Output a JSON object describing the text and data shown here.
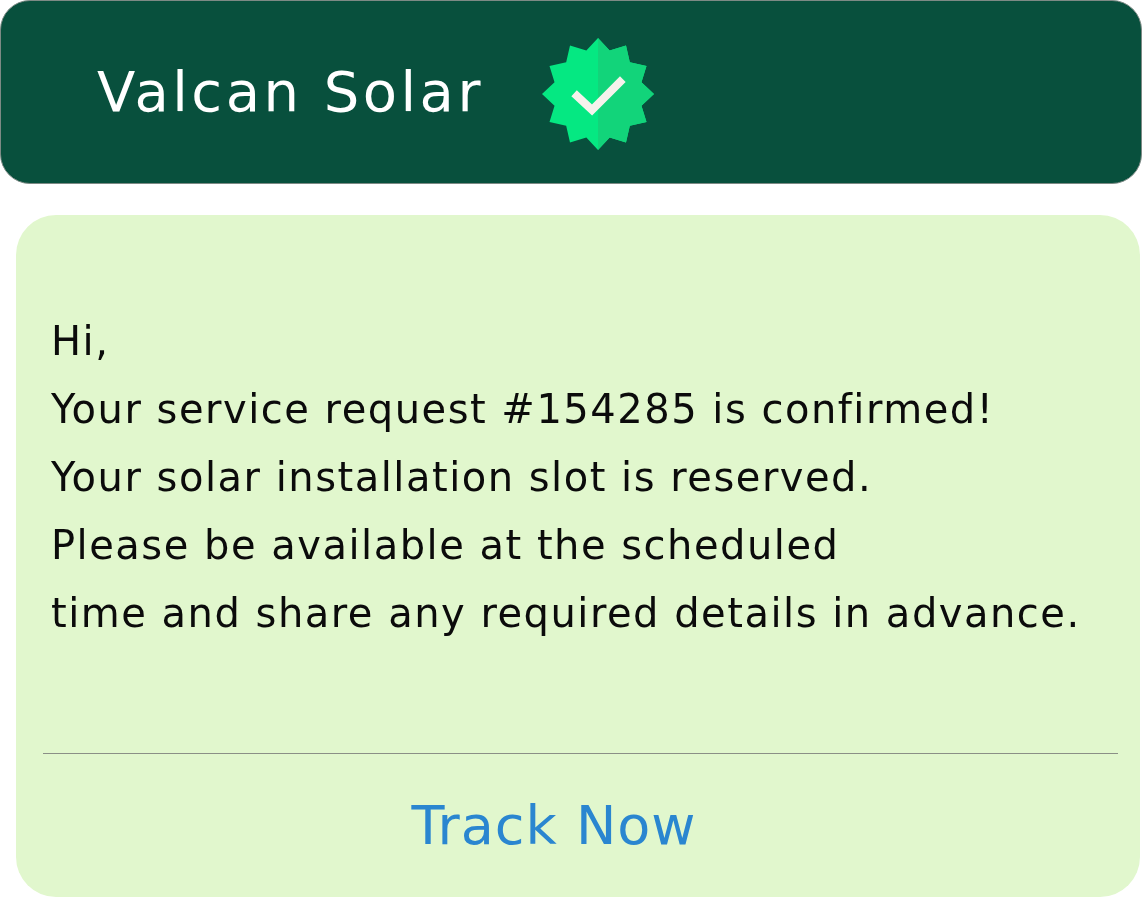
{
  "header": {
    "title": "Valcan Solar",
    "verified": true
  },
  "message": {
    "greeting": "Hi,",
    "lines": [
      "Your service request #154285 is confirmed!",
      "Your solar installation slot is reserved.",
      "Please be available at the scheduled",
      "time and share any required details in advance."
    ]
  },
  "action": {
    "label": "Track Now"
  }
}
